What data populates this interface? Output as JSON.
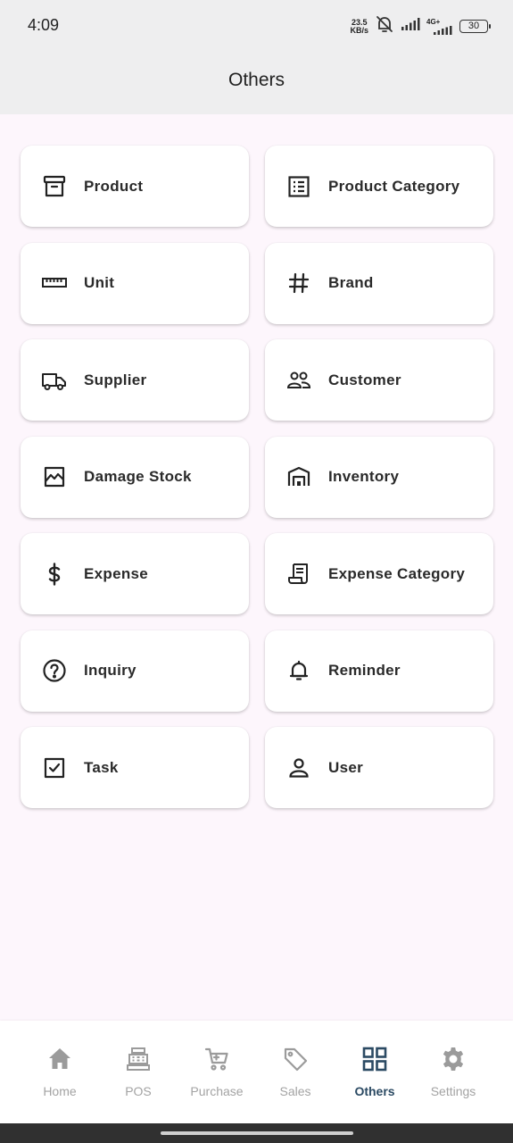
{
  "status_bar": {
    "time": "4:09",
    "net_speed_value": "23.5",
    "net_speed_unit": "KB/s",
    "network_type": "4G+",
    "battery": "30"
  },
  "header": {
    "title": "Others"
  },
  "menu": {
    "items": [
      {
        "label": "Product",
        "icon": "archive-box-icon"
      },
      {
        "label": "Product Category",
        "icon": "list-icon"
      },
      {
        "label": "Unit",
        "icon": "ruler-icon"
      },
      {
        "label": "Brand",
        "icon": "hash-icon"
      },
      {
        "label": "Supplier",
        "icon": "truck-icon"
      },
      {
        "label": "Customer",
        "icon": "users-icon"
      },
      {
        "label": "Damage Stock",
        "icon": "chart-image-icon"
      },
      {
        "label": "Inventory",
        "icon": "warehouse-icon"
      },
      {
        "label": "Expense",
        "icon": "dollar-icon"
      },
      {
        "label": "Expense Category",
        "icon": "receipt-icon"
      },
      {
        "label": "Inquiry",
        "icon": "question-circle-icon"
      },
      {
        "label": "Reminder",
        "icon": "bell-icon"
      },
      {
        "label": "Task",
        "icon": "checkbox-icon"
      },
      {
        "label": "User",
        "icon": "user-icon"
      }
    ]
  },
  "bottom_nav": {
    "items": [
      {
        "label": "Home",
        "icon": "home-icon",
        "active": false
      },
      {
        "label": "POS",
        "icon": "cash-register-icon",
        "active": false
      },
      {
        "label": "Purchase",
        "icon": "cart-icon",
        "active": false
      },
      {
        "label": "Sales",
        "icon": "tag-icon",
        "active": false
      },
      {
        "label": "Others",
        "icon": "grid-icon",
        "active": true
      },
      {
        "label": "Settings",
        "icon": "gear-icon",
        "active": false
      }
    ]
  },
  "colors": {
    "background": "#fdf6fc",
    "app_bar": "#eeeeef",
    "card": "#ffffff",
    "active_nav": "#2b4a63",
    "inactive_nav": "#a3a3a3"
  }
}
